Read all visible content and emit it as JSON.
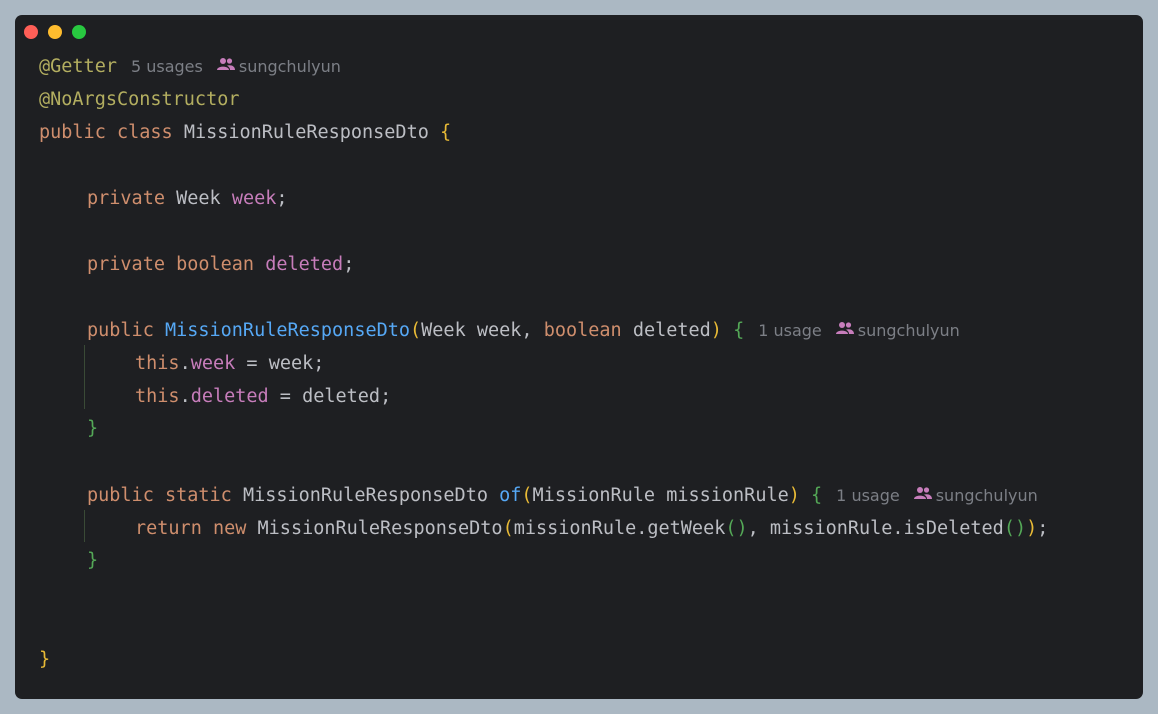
{
  "window": {
    "traffic_lights": [
      "close",
      "minimize",
      "maximize"
    ],
    "colors": {
      "close": "#ff5f57",
      "minimize": "#febc2e",
      "maximize": "#28c840"
    }
  },
  "code": {
    "annotation_getter": "@Getter",
    "getter_usages": "5 usages",
    "getter_author": "sungchulyun",
    "annotation_noargs": "@NoArgsConstructor",
    "kw_public": "public",
    "kw_class": "class",
    "class_name": "MissionRuleResponseDto",
    "kw_private": "private",
    "type_week": "Week",
    "field_week": "week",
    "kw_boolean": "boolean",
    "field_deleted": "deleted",
    "ctor_name": "MissionRuleResponseDto",
    "param_type_week": "Week",
    "param_week": "week",
    "param_type_boolean": "boolean",
    "param_deleted": "deleted",
    "ctor_usages": "1 usage",
    "ctor_author": "sungchulyun",
    "kw_this": "this",
    "assign_week_rhs": "week",
    "assign_deleted_rhs": "deleted",
    "kw_static": "static",
    "return_type": "MissionRuleResponseDto",
    "method_of": "of",
    "param_type_missionrule": "MissionRule",
    "param_missionrule": "missionRule",
    "of_usages": "1 usage",
    "of_author": "sungchulyun",
    "kw_return": "return",
    "kw_new": "new",
    "new_type": "MissionRuleResponseDto",
    "call_getweek": "missionRule.getWeek",
    "call_isdeleted": "missionRule.isDeleted"
  },
  "syntax_colors": {
    "annotation": "#b3ae60",
    "keyword": "#cf8e6d",
    "field": "#c77dbb",
    "function": "#56a8f5",
    "text": "#bcbec4",
    "bracket_level1": "#e8ba36",
    "bracket_level2": "#54a857",
    "bracket_level3": "#4fa4d6",
    "hint": "#7c7f86",
    "author_icon": "#c77dbb",
    "background": "#1e1f22",
    "frame": "#abb8c3"
  }
}
